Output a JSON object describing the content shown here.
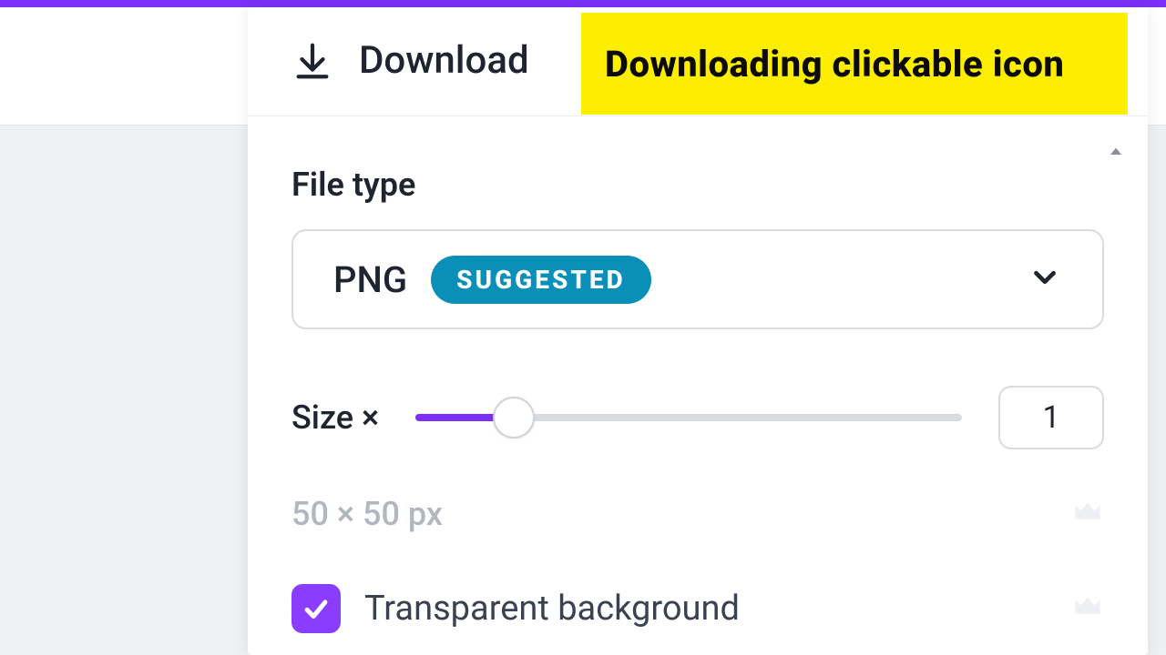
{
  "annotation": {
    "text": "Downloading clickable icon"
  },
  "panel": {
    "title": "Download",
    "file_type": {
      "label": "File type",
      "value": "PNG",
      "badge": "SUGGESTED"
    },
    "size": {
      "label": "Size ×",
      "value": "1",
      "dimensions": "50 × 50 px"
    },
    "transparent_bg": {
      "label": "Transparent background",
      "checked": true
    }
  }
}
